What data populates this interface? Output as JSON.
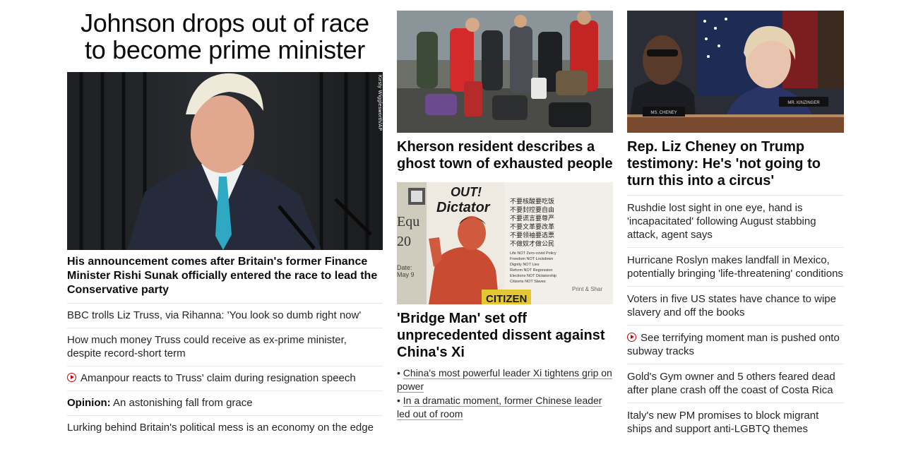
{
  "lead": {
    "title": "Johnson drops out of race to become prime minister",
    "photo_credit": "Kirsty Wigglesworth/AP",
    "caption": "His announcement comes after Britain's former Finance Minister Rishi Sunak officially entered the race to lead the Conservative party",
    "links": [
      {
        "text": "BBC trolls Liz Truss, via Rihanna: 'You look so dumb right now'"
      },
      {
        "text": "How much money Truss could receive as ex-prime minister, despite record-short term"
      },
      {
        "text": "Amanpour reacts to Truss' claim during resignation speech",
        "icon": "play-icon"
      },
      {
        "prefix": "Opinion:",
        "text": "An astonishing fall from grace"
      },
      {
        "text": "Lurking behind Britain's political mess is an economy on the edge"
      }
    ]
  },
  "middle": {
    "card1": {
      "title": "Kherson resident describes a ghost town of exhausted people"
    },
    "card2": {
      "poster_text": {
        "line1": "OUT!",
        "line2": "Dictator",
        "left1": "Equ",
        "left2": "20",
        "left3": "Date:",
        "left4": "May 9",
        "bottom": "CITIZEN",
        "right_bottom": "Print & Shar",
        "cjk_lines": [
          "不要核酸要吃饭",
          "不要封控要自由",
          "不要谎言要尊严",
          "不要文革要改革",
          "不要领袖要选票",
          "不做奴才做公民"
        ],
        "eng_lines": [
          "Life NOT Zero-covid Policy",
          "Freedom NOT Lockdown",
          "Dignity NOT Lies",
          "Reform NOT Regression",
          "Elections NOT Dictatorship",
          "Citizens NOT Slaves"
        ]
      },
      "title": "'Bridge Man' set off unprecedented dissent against China's Xi",
      "links": [
        "China's most powerful leader Xi tightens grip on power",
        "In a dramatic moment, former Chinese leader led out of room"
      ]
    }
  },
  "right": {
    "photo_labels": {
      "left": "MS. CHENEY",
      "right": "MR. KINZINGER"
    },
    "title": "Rep. Liz Cheney on Trump testimony: He's 'not going to turn this into a circus'",
    "links": [
      {
        "text": "Rushdie lost sight in one eye, hand is 'incapacitated' following August stabbing attack, agent says"
      },
      {
        "text": "Hurricane Roslyn makes landfall in Mexico, potentially bringing 'life-threatening' conditions"
      },
      {
        "text": "Voters in five US states have chance to wipe slavery and off the books"
      },
      {
        "text": "See terrifying moment man is pushed onto subway tracks",
        "icon": "play-icon"
      },
      {
        "text": "Gold's Gym owner and 5 others feared dead after plane crash off the coast of Costa Rica"
      },
      {
        "text": "Italy's new PM promises to block migrant ships and support anti-LGBTQ themes"
      }
    ]
  },
  "colors": {
    "accent_red": "#cc0000",
    "text": "#0c0c0c",
    "divider": "#e6e6e6"
  }
}
